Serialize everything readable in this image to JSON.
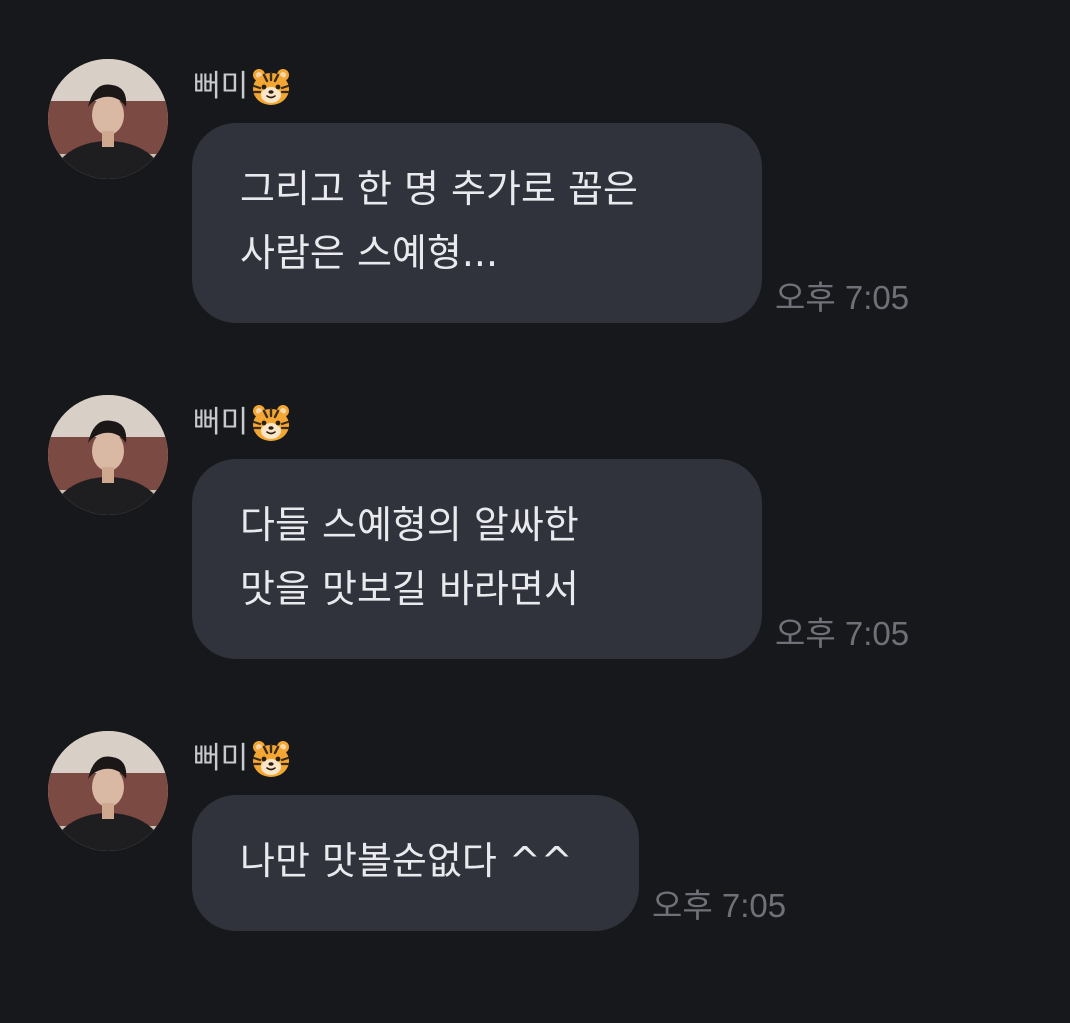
{
  "messages": [
    {
      "sender": "뻐미",
      "sender_emoji": "tiger-face",
      "lines": [
        "그리고 한 명 추가로 꼽은",
        "사람은 스예형..."
      ],
      "time": "오후 7:05"
    },
    {
      "sender": "뻐미",
      "sender_emoji": "tiger-face",
      "lines": [
        "다들 스예형의 알싸한",
        "맛을 맛보길 바라면서"
      ],
      "time": "오후 7:05"
    },
    {
      "sender": "뻐미",
      "sender_emoji": "tiger-face",
      "lines": [
        "나만 맛볼순없다 ^^"
      ],
      "time": "오후 7:05"
    }
  ],
  "colors": {
    "background": "#17181c",
    "bubble": "#30333b",
    "text": "#e9eaee",
    "sender": "#c9cacf",
    "time": "#6f7179"
  }
}
